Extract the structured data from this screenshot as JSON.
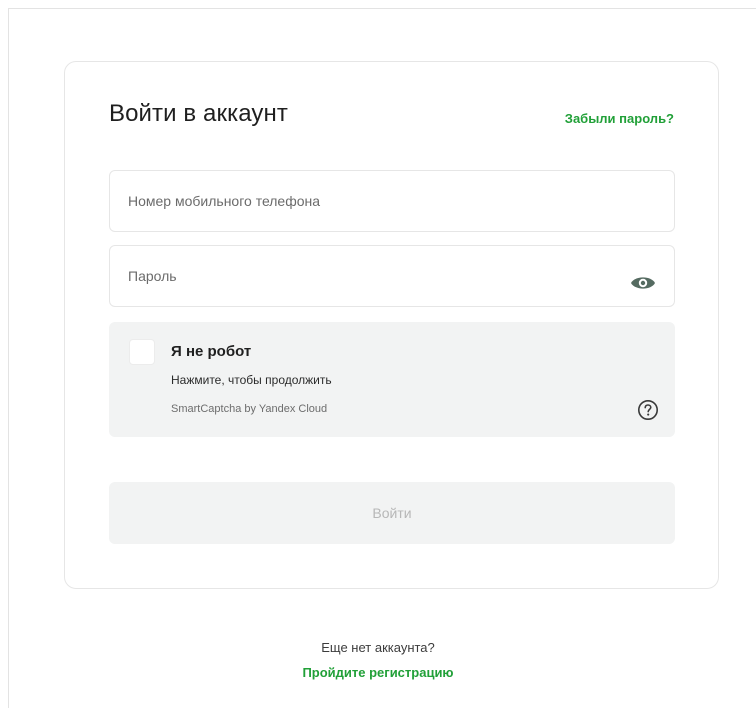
{
  "login": {
    "title": "Войти в аккаунт",
    "forgot_password": "Забыли пароль?",
    "phone_placeholder": "Номер мобильного телефона",
    "password_placeholder": "Пароль",
    "password_toggle_icon": "eye-icon",
    "submit_label": "Войти"
  },
  "captcha": {
    "title": "Я не робот",
    "subtitle": "Нажмите, чтобы продолжить",
    "brand": "SmartCaptcha by Yandex Cloud",
    "checked": false,
    "help_icon": "question-circle-icon"
  },
  "footer": {
    "no_account": "Еще нет аккаунта?",
    "register_link": "Пройдите регистрацию"
  },
  "colors": {
    "accent": "#21a038",
    "field_border": "#e6e6e6",
    "muted_bg": "#f2f3f3",
    "disabled_text": "#b7b7b7",
    "eye_icon": "#556b61"
  }
}
